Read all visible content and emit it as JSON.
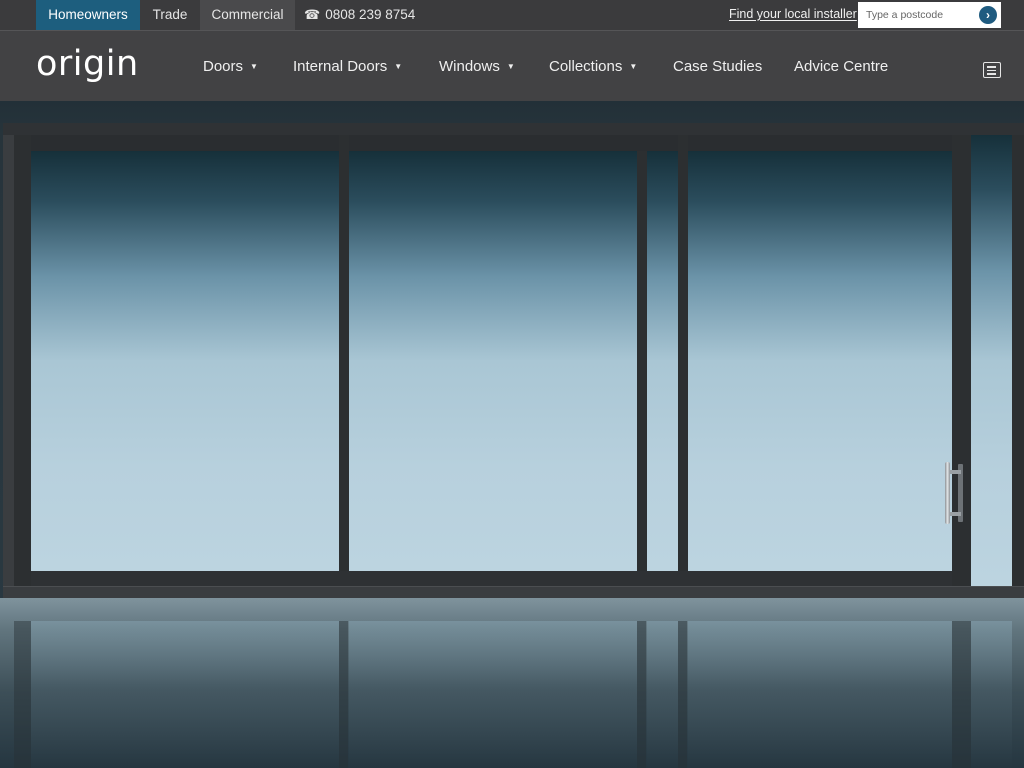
{
  "topbar": {
    "segments": [
      "Homeowners",
      "Trade",
      "Commercial"
    ],
    "phone_icon": "phone-icon",
    "phone": "0808 239 8754",
    "installer_link": "Find your local installer",
    "postcode_placeholder": "Type a postcode",
    "postcode_go_icon": "chevron-right-icon"
  },
  "nav": {
    "logo": "origin",
    "items": [
      {
        "label": "Doors",
        "has_dropdown": true
      },
      {
        "label": "Internal Doors",
        "has_dropdown": true
      },
      {
        "label": "Windows",
        "has_dropdown": true
      },
      {
        "label": "Collections",
        "has_dropdown": true
      },
      {
        "label": "Case Studies",
        "has_dropdown": false
      },
      {
        "label": "Advice Centre",
        "has_dropdown": false
      }
    ],
    "menu_icon": "hamburger-menu-icon"
  },
  "colors": {
    "active_segment": "#1d5e7e",
    "topbar_bg": "#3b3b3d",
    "nav_bg": "#424244",
    "go_button": "#1f5b80"
  }
}
